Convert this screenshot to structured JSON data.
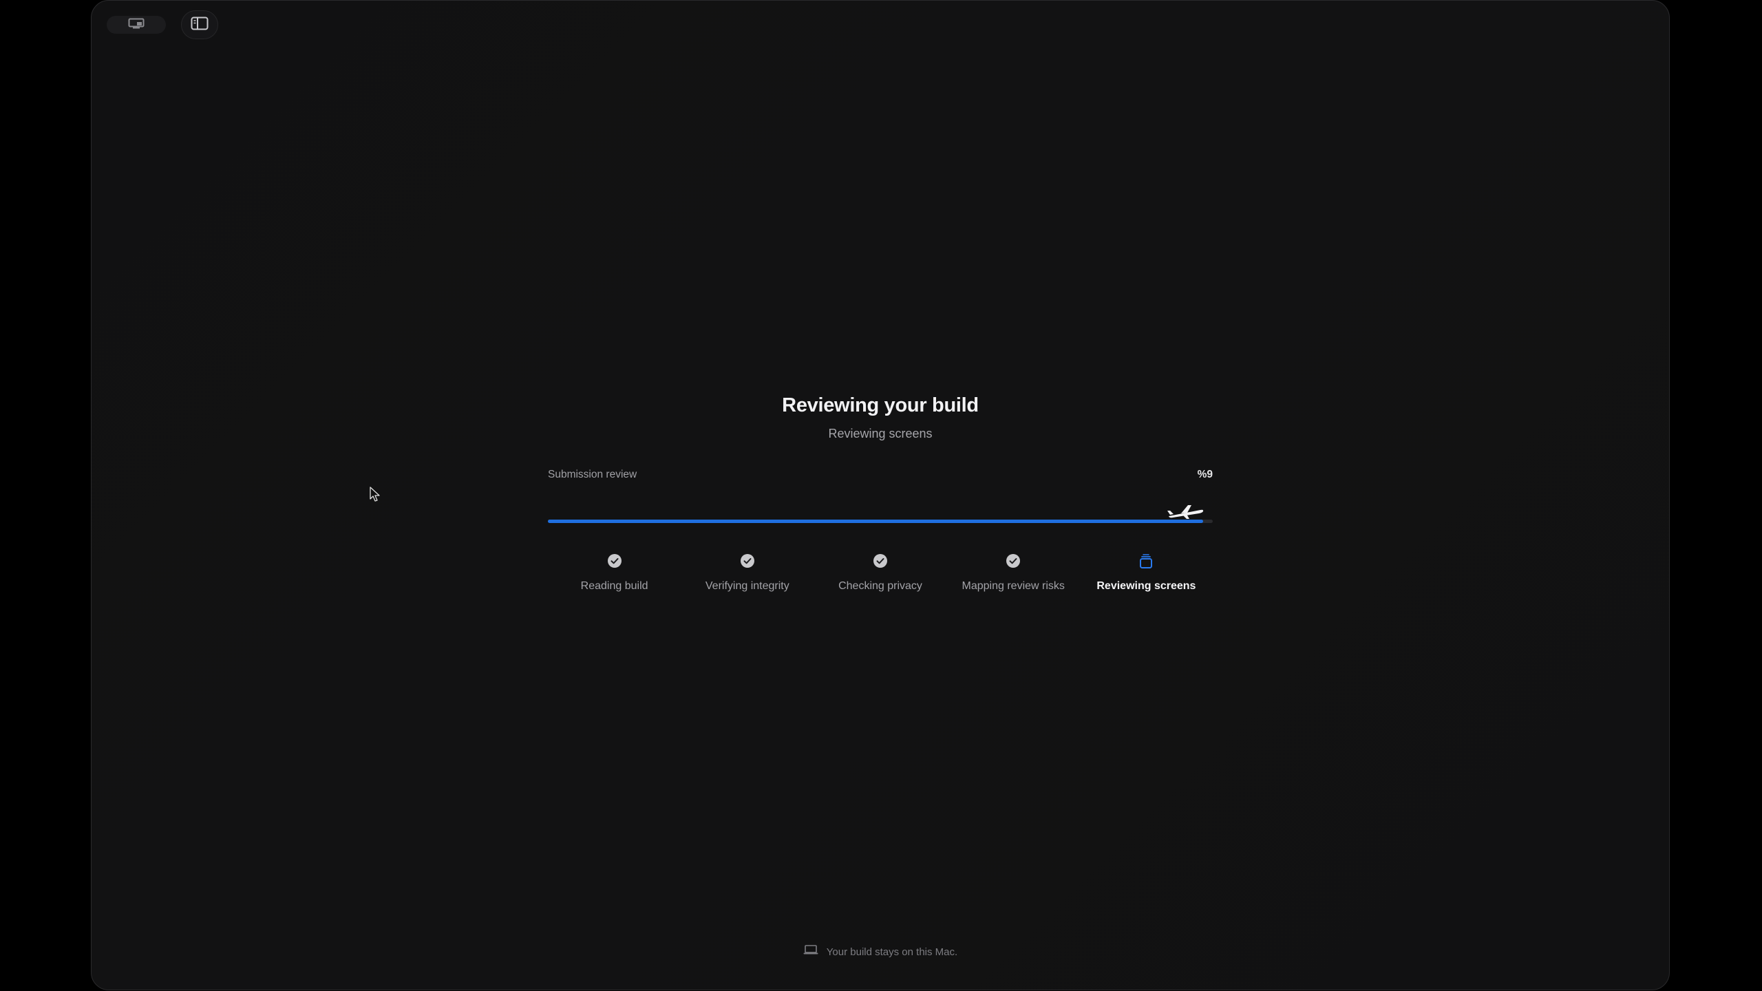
{
  "window": {
    "title": "Reviewing your build",
    "subtitle": "Reviewing screens"
  },
  "progress": {
    "label": "Submission review",
    "percent_text": "%9",
    "fraction": 0.985,
    "accent_color": "#1f6fe0"
  },
  "steps": [
    {
      "label": "Reading build",
      "state": "done",
      "icon": "checkmark-circle-icon"
    },
    {
      "label": "Verifying integrity",
      "state": "done",
      "icon": "checkmark-circle-icon"
    },
    {
      "label": "Checking privacy",
      "state": "done",
      "icon": "checkmark-circle-icon"
    },
    {
      "label": "Mapping review risks",
      "state": "done",
      "icon": "checkmark-circle-icon"
    },
    {
      "label": "Reviewing screens",
      "state": "active",
      "icon": "stacked-screens-icon"
    }
  ],
  "footer": {
    "text": "Your build stays on this Mac.",
    "icon": "laptop-icon"
  },
  "toolbar": {
    "left_icon": "display-icon",
    "right_icon": "sidebar-toggle-icon"
  }
}
